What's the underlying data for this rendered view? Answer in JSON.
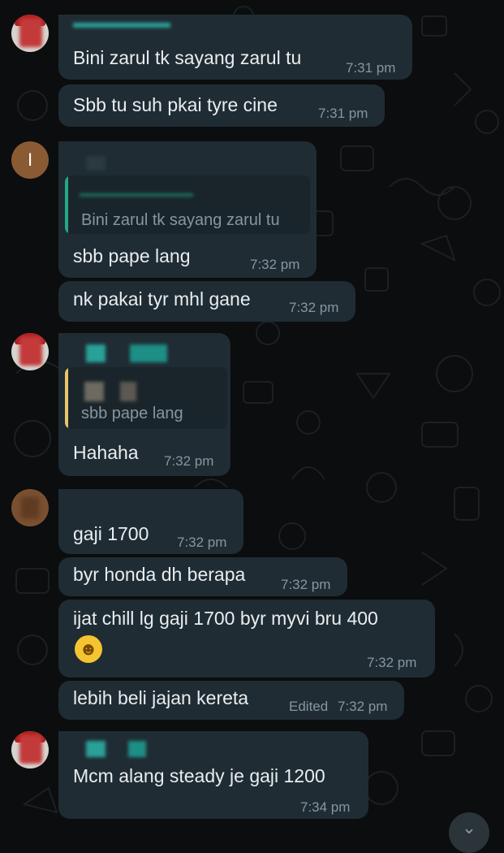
{
  "messages": [
    {
      "text": "Bini zarul tk sayang zarul tu",
      "time": "7:31 pm"
    },
    {
      "text": "Sbb tu suh pkai tyre cine",
      "time": "7:31 pm"
    },
    {
      "quote": "Bini zarul tk sayang zarul tu",
      "text": "sbb pape lang",
      "time": "7:32 pm"
    },
    {
      "text": "nk pakai tyr mhl gane",
      "time": "7:32 pm"
    },
    {
      "quote": "sbb pape lang",
      "text": "Hahaha",
      "time": "7:32 pm"
    },
    {
      "text": "gaji 1700",
      "time": "7:32 pm"
    },
    {
      "text": "byr honda dh berapa",
      "time": "7:32 pm"
    },
    {
      "text": "ijat chill lg gaji 1700 byr myvi bru 400",
      "time": "7:32 pm",
      "emoji": "winking-tongue-face"
    },
    {
      "text": "lebih beli jajan kereta",
      "edited": "Edited",
      "time": "7:32 pm"
    },
    {
      "text": "Mcm alang steady je gaji 1200",
      "time": "7:34 pm"
    }
  ],
  "avatars": {
    "user2_initial": "I"
  },
  "colors": {
    "background": "#0b0d0e",
    "bubble": "#1f2c33",
    "quote_bar_green": "#25a884",
    "quote_bar_yellow": "#e9c46a",
    "sender_teal": "#2aa198",
    "timestamp": "#8696a0"
  }
}
